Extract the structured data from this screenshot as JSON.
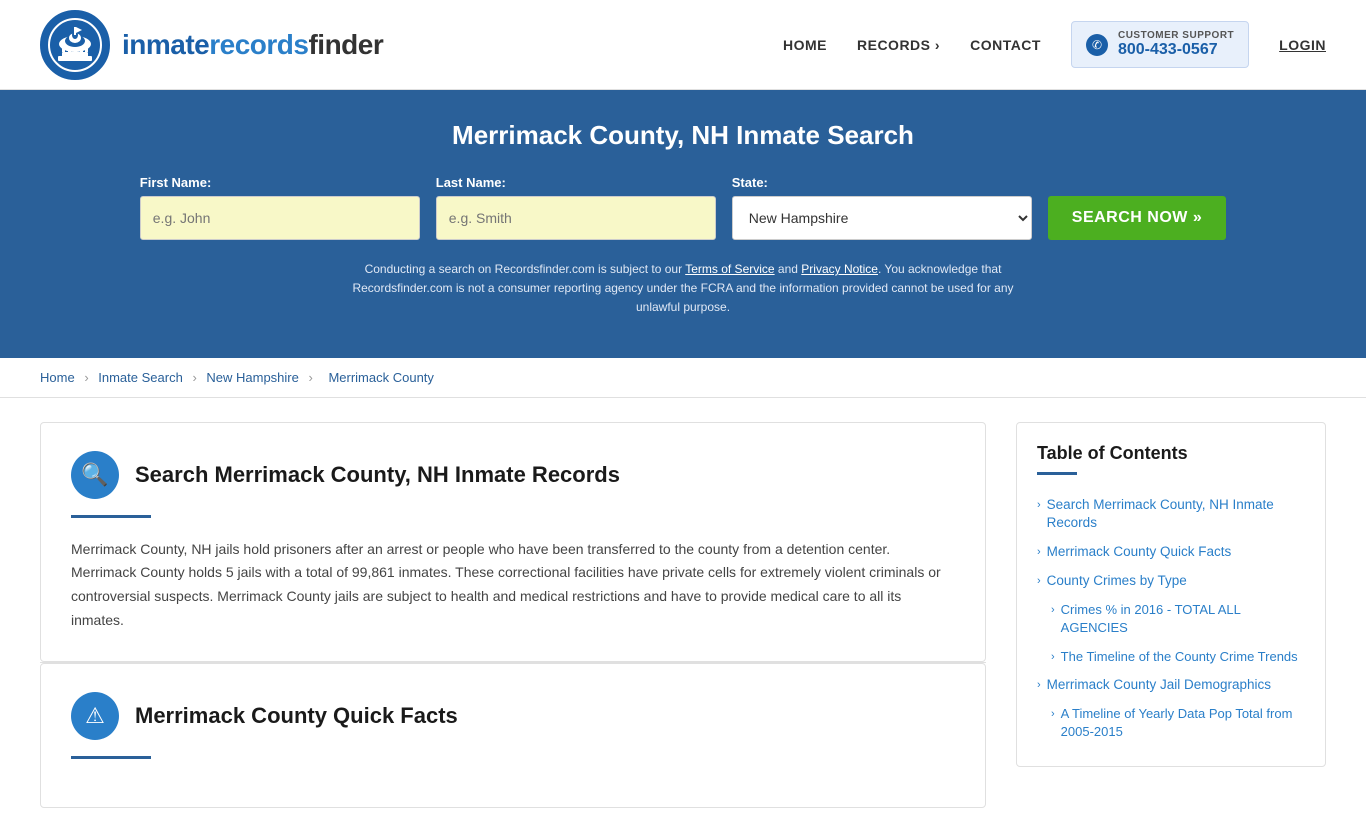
{
  "header": {
    "logo_text_inmate": "inmate",
    "logo_text_records": "records",
    "logo_text_finder": "finder",
    "nav": {
      "home": "HOME",
      "records": "RECORDS",
      "contact": "CONTACT",
      "login": "LOGIN"
    },
    "support": {
      "label": "CUSTOMER SUPPORT",
      "phone": "800-433-0567"
    }
  },
  "hero": {
    "title": "Merrimack County, NH Inmate Search",
    "form": {
      "first_name_label": "First Name:",
      "first_name_placeholder": "e.g. John",
      "last_name_label": "Last Name:",
      "last_name_placeholder": "e.g. Smith",
      "state_label": "State:",
      "state_value": "New Hampshire",
      "search_btn": "SEARCH NOW »"
    },
    "disclaimer": "Conducting a search on Recordsfinder.com is subject to our Terms of Service and Privacy Notice. You acknowledge that Recordsfinder.com is not a consumer reporting agency under the FCRA and the information provided cannot be used for any unlawful purpose."
  },
  "breadcrumb": {
    "home": "Home",
    "inmate_search": "Inmate Search",
    "state": "New Hampshire",
    "county": "Merrimack County"
  },
  "main": {
    "section1": {
      "title": "Search Merrimack County, NH Inmate Records",
      "body": "Merrimack County, NH jails hold prisoners after an arrest or people who have been transferred to the county from a detention center. Merrimack County holds 5 jails with a total of 99,861 inmates. These correctional facilities have private cells for extremely violent criminals or controversial suspects. Merrimack County jails are subject to health and medical restrictions and have to provide medical care to all its inmates."
    },
    "section2": {
      "title": "Merrimack County Quick Facts"
    }
  },
  "toc": {
    "title": "Table of Contents",
    "items": [
      {
        "label": "Search Merrimack County, NH Inmate Records",
        "sub": false
      },
      {
        "label": "Merrimack County Quick Facts",
        "sub": false
      },
      {
        "label": "County Crimes by Type",
        "sub": false
      },
      {
        "label": "Crimes % in 2016 - TOTAL ALL AGENCIES",
        "sub": true
      },
      {
        "label": "The Timeline of the County Crime Trends",
        "sub": true
      },
      {
        "label": "Merrimack County Jail Demographics",
        "sub": false
      },
      {
        "label": "A Timeline of Yearly Data Pop Total from 2005-2015",
        "sub": true
      }
    ]
  }
}
